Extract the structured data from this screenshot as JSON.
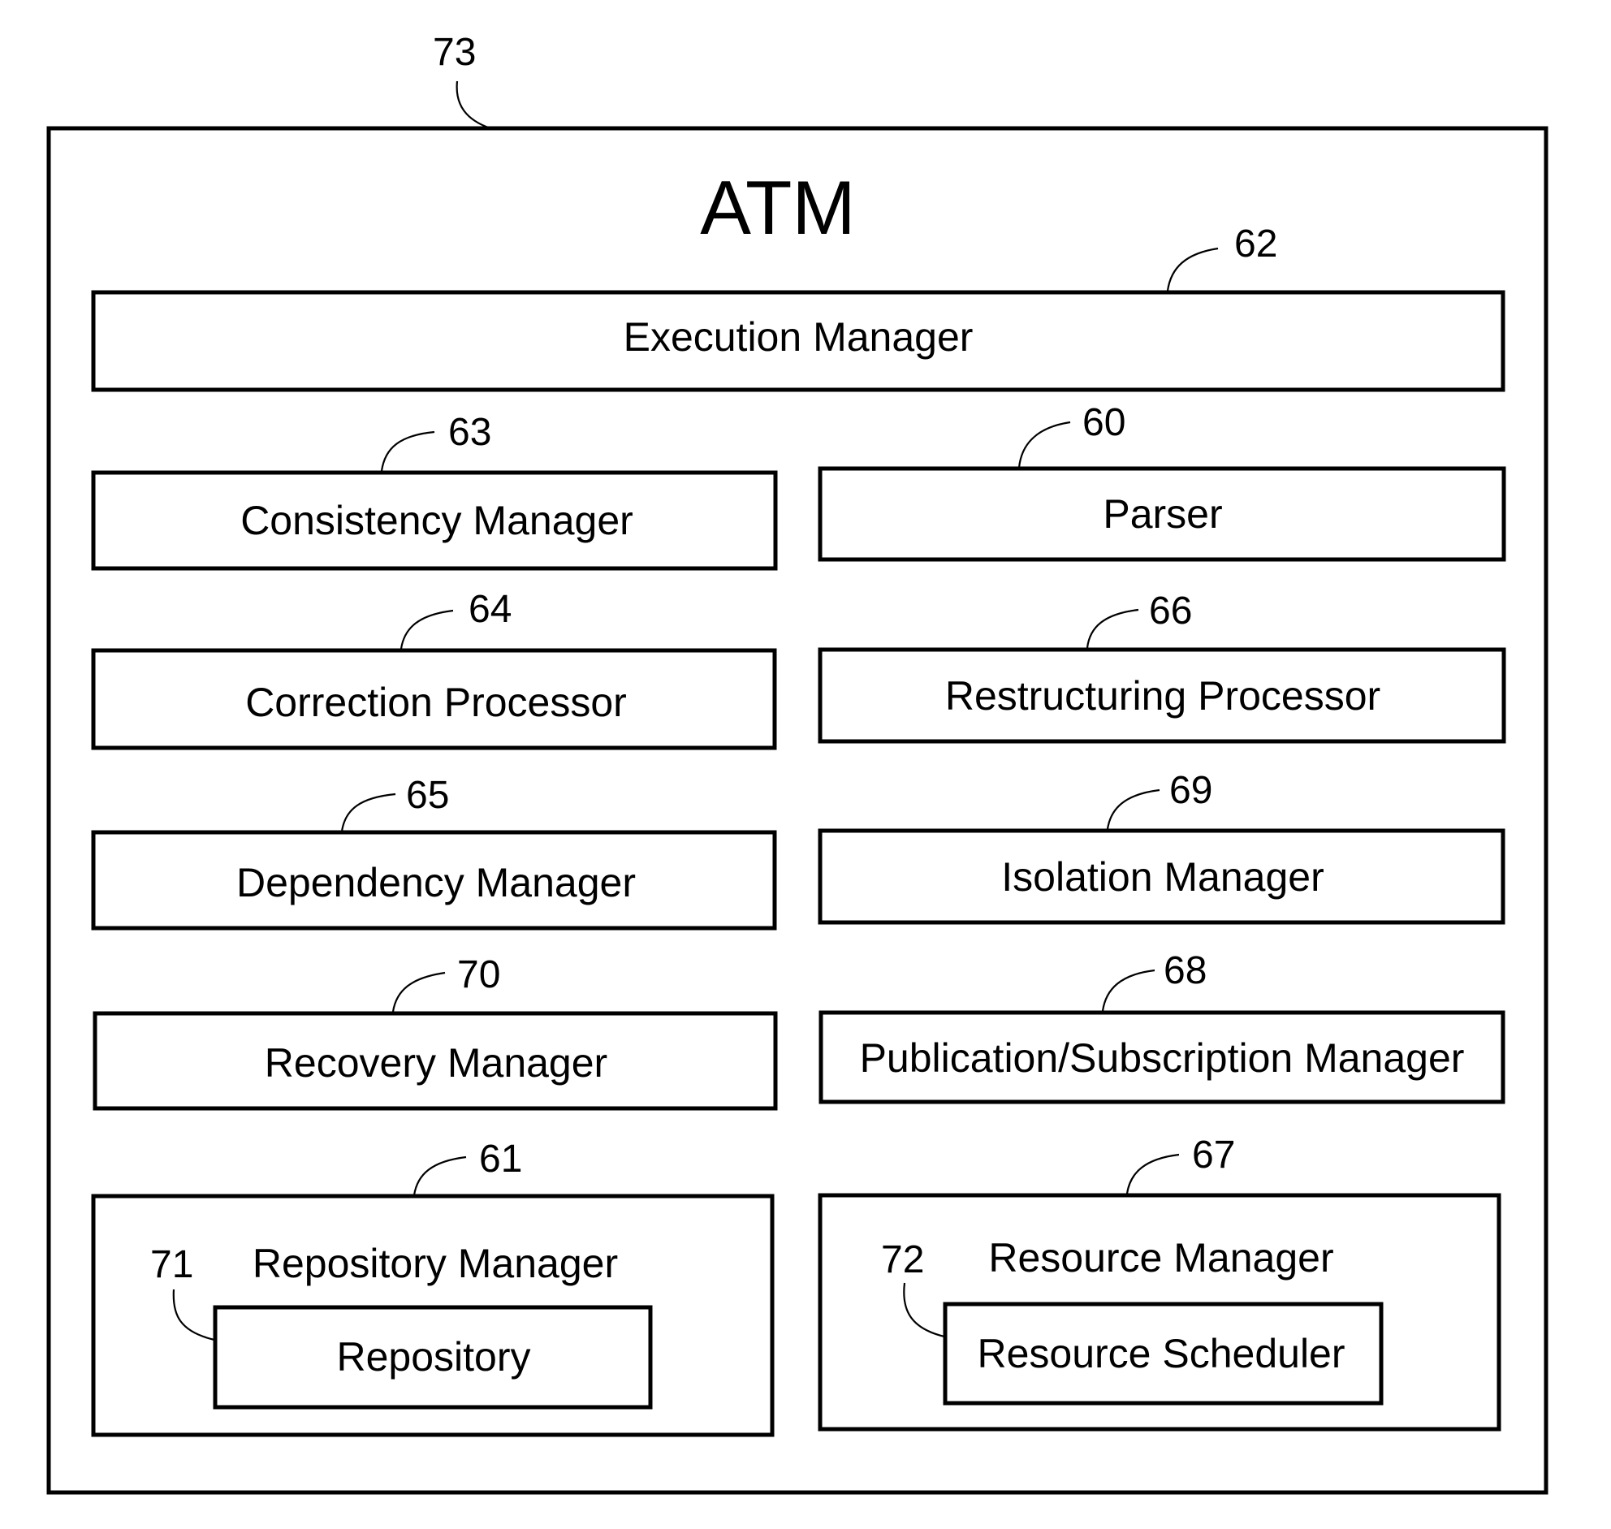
{
  "diagram": {
    "title": "ATM",
    "container_ref": "73",
    "components": [
      {
        "id": "execution-manager",
        "label": "Execution Manager",
        "ref": "62"
      },
      {
        "id": "consistency-manager",
        "label": "Consistency Manager",
        "ref": "63"
      },
      {
        "id": "parser",
        "label": "Parser",
        "ref": "60"
      },
      {
        "id": "correction-processor",
        "label": "Correction Processor",
        "ref": "64"
      },
      {
        "id": "restructuring-processor",
        "label": "Restructuring Processor",
        "ref": "66"
      },
      {
        "id": "dependency-manager",
        "label": "Dependency Manager",
        "ref": "65"
      },
      {
        "id": "isolation-manager",
        "label": "Isolation Manager",
        "ref": "69"
      },
      {
        "id": "recovery-manager",
        "label": "Recovery Manager",
        "ref": "70"
      },
      {
        "id": "publication-subscription-manager",
        "label": "Publication/Subscription Manager",
        "ref": "68"
      },
      {
        "id": "repository-manager",
        "label": "Repository Manager",
        "ref": "61",
        "child": {
          "id": "repository",
          "label": "Repository",
          "ref": "71"
        }
      },
      {
        "id": "resource-manager",
        "label": "Resource Manager",
        "ref": "67",
        "child": {
          "id": "resource-scheduler",
          "label": "Resource Scheduler",
          "ref": "72"
        }
      }
    ]
  }
}
